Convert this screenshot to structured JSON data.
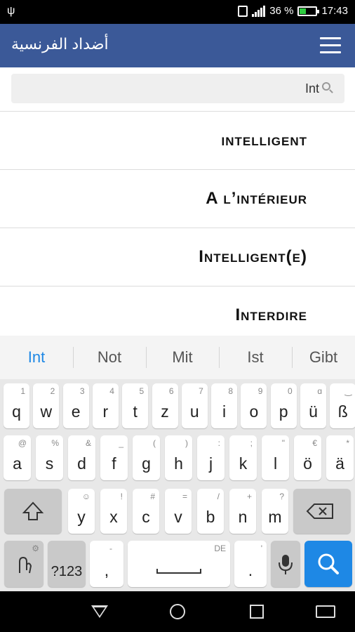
{
  "status": {
    "percent": "36 %",
    "time": "17:43"
  },
  "app": {
    "title": "أضداد الفرنسية"
  },
  "search": {
    "value": "Int"
  },
  "results": [
    {
      "text": "intelligent"
    },
    {
      "text": "A l’intérieur"
    },
    {
      "text": "Intelligent(e)"
    },
    {
      "text": "Interdire"
    }
  ],
  "keyboard": {
    "suggestions": [
      "Int",
      "Not",
      "Mit",
      "Ist",
      "Gibt"
    ],
    "row1": [
      {
        "k": "q",
        "h": "1"
      },
      {
        "k": "w",
        "h": "2"
      },
      {
        "k": "e",
        "h": "3"
      },
      {
        "k": "r",
        "h": "4"
      },
      {
        "k": "t",
        "h": "5"
      },
      {
        "k": "z",
        "h": "6"
      },
      {
        "k": "u",
        "h": "7"
      },
      {
        "k": "i",
        "h": "8"
      },
      {
        "k": "o",
        "h": "9"
      },
      {
        "k": "p",
        "h": "0"
      },
      {
        "k": "ü",
        "h": "ɑ"
      },
      {
        "k": "ß",
        "h": "‿"
      }
    ],
    "row2": [
      {
        "k": "a",
        "h": "@"
      },
      {
        "k": "s",
        "h": "%"
      },
      {
        "k": "d",
        "h": "&"
      },
      {
        "k": "f",
        "h": "_"
      },
      {
        "k": "g",
        "h": "("
      },
      {
        "k": "h",
        "h": ")"
      },
      {
        "k": "j",
        "h": ":"
      },
      {
        "k": "k",
        "h": ";"
      },
      {
        "k": "l",
        "h": "\""
      },
      {
        "k": "ö",
        "h": "€"
      },
      {
        "k": "ä",
        "h": "*"
      }
    ],
    "row3": [
      {
        "k": "y",
        "h": "☺"
      },
      {
        "k": "x",
        "h": "!"
      },
      {
        "k": "c",
        "h": "#"
      },
      {
        "k": "v",
        "h": "="
      },
      {
        "k": "b",
        "h": "/"
      },
      {
        "k": "n",
        "h": "+"
      },
      {
        "k": "m",
        "h": "?"
      }
    ],
    "sym_label": "?123",
    "comma": ",",
    "comma_hint": "-",
    "space_hint": "DE",
    "period": ".",
    "period_hint": "'"
  }
}
